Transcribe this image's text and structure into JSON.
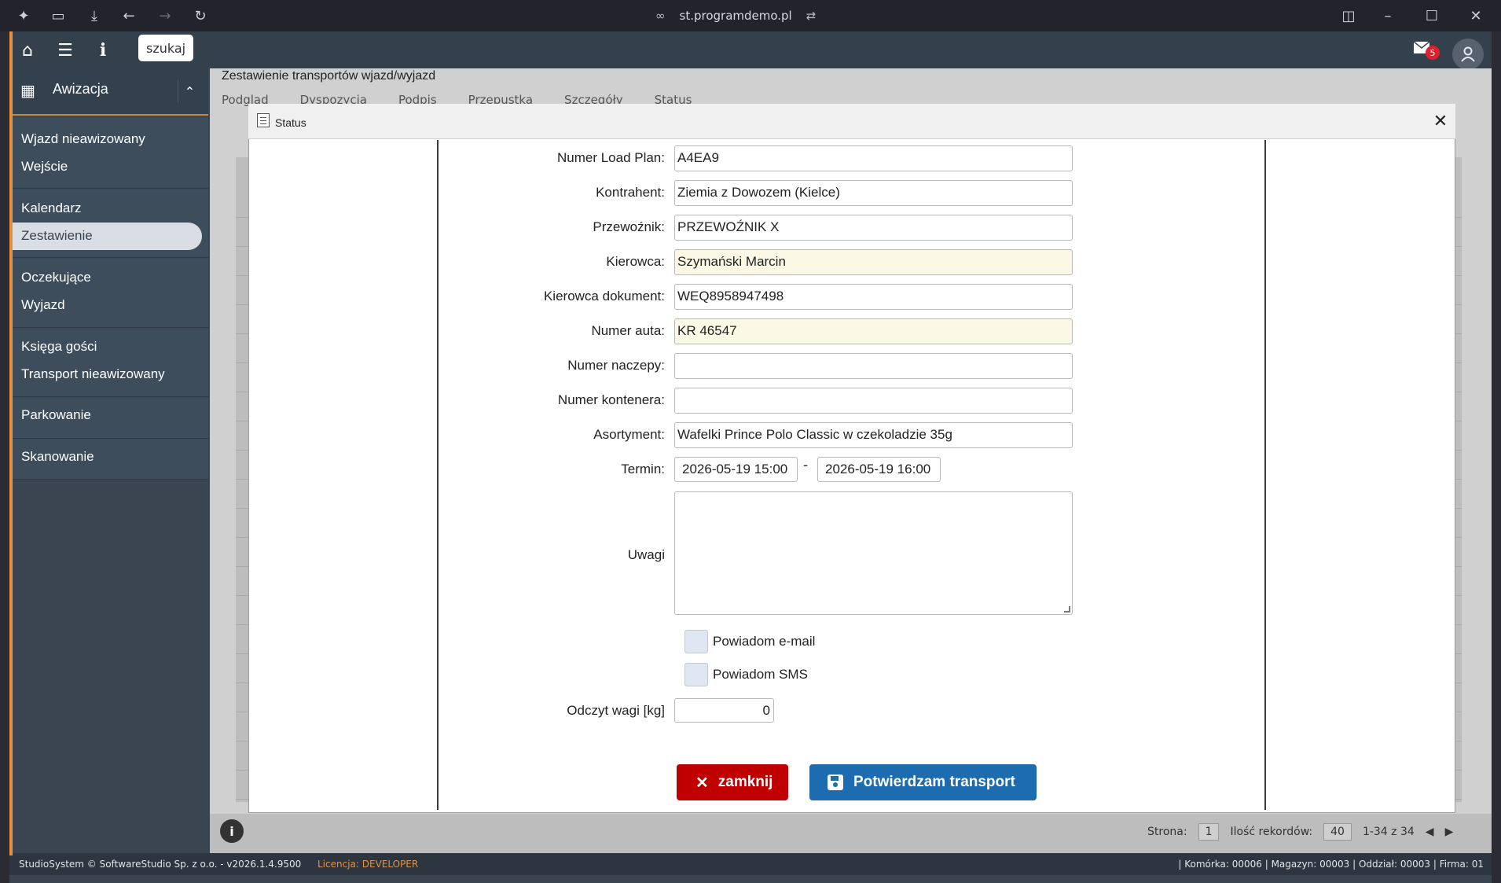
{
  "browser": {
    "url": "st.programdemo.pl"
  },
  "appbar": {
    "search_label": "szukaj",
    "mail_count": "5"
  },
  "sidebar": {
    "section_title": "Awizacja",
    "items": [
      "Wjazd nieawizowany",
      "Wejście",
      "Kalendarz",
      "Zestawienie",
      "Oczekujące",
      "Wyjazd",
      "Księga gości",
      "Transport nieawizowany",
      "Parkowanie",
      "Skanowanie"
    ],
    "active_item": "Zestawienie"
  },
  "main": {
    "title": "Zestawienie transportów wjazd/wyjazd",
    "toolbar": [
      "Podgląd",
      "Dyspozycja",
      "Podpis",
      "Przepustka",
      "Szczegóły",
      "Status"
    ]
  },
  "pager": {
    "page_label": "Strona:",
    "page_value": "1",
    "records_label": "Ilość rekordów:",
    "records_value": "40",
    "range": "1-34 z 34"
  },
  "footer": {
    "left": "StudioSystem © SoftwareStudio Sp. z o.o. - v2026.1.4.9500",
    "license": "Licencja: DEVELOPER",
    "right": "| Komórka: 00006 | Magazyn: 00003 | Oddział: 00003 | Firma: 01"
  },
  "dialog": {
    "title": "Status",
    "fields": {
      "load_plan": {
        "label": "Numer Load Plan:",
        "value": "A4EA9"
      },
      "kontrahent": {
        "label": "Kontrahent:",
        "value": "Ziemia z Dowozem (Kielce)"
      },
      "przewoznik": {
        "label": "Przewoźnik:",
        "value": "PRZEWOŹNIK X"
      },
      "kierowca": {
        "label": "Kierowca:",
        "value": "Szymański Marcin"
      },
      "kierowca_dok": {
        "label": "Kierowca dokument:",
        "value": "WEQ8958947498"
      },
      "numer_auta": {
        "label": "Numer auta:",
        "value": "KR 46547"
      },
      "numer_naczepy": {
        "label": "Numer naczepy:",
        "value": ""
      },
      "numer_kontenera": {
        "label": "Numer kontenera:",
        "value": ""
      },
      "asortyment": {
        "label": "Asortyment:",
        "value": "Wafelki Prince Polo Classic w czekoladzie 35g"
      },
      "termin": {
        "label": "Termin:",
        "from": "2026-05-19 15:00",
        "to": "2026-05-19 16:00",
        "separator": "-"
      },
      "uwagi": {
        "label": "Uwagi",
        "value": ""
      },
      "powiadom_email": {
        "label": "Powiadom e-mail",
        "checked": false
      },
      "powiadom_sms": {
        "label": "Powiadom SMS",
        "checked": false
      },
      "odczyt_wagi": {
        "label": "Odczyt wagi [kg]",
        "value": "0"
      }
    },
    "buttons": {
      "close": "zamknij",
      "confirm": "Potwierdzam transport"
    }
  },
  "colors": {
    "accent": "#e8903a",
    "sidebar": "#3a4a5a",
    "close_button": "#c00000",
    "confirm_button": "#1e6cb0",
    "required_field": "#fbf8e6"
  }
}
